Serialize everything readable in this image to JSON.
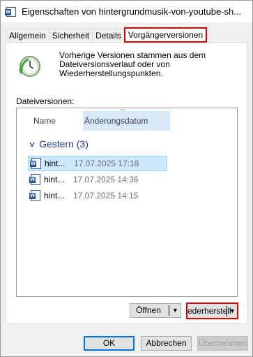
{
  "window": {
    "title": "Eigenschaften von hintergrundmusik-von-youtube-sh...",
    "icon": "word-document-icon"
  },
  "tabs": [
    {
      "label": "Allgemein",
      "active": false
    },
    {
      "label": "Sicherheit",
      "active": false
    },
    {
      "label": "Details",
      "active": false
    },
    {
      "label": "Vorgängerversionen",
      "active": true
    }
  ],
  "panel": {
    "info_text": "Vorherige Versionen stammen aus dem Dateiversionsverlauf oder von Wiederherstellungspunkten.",
    "versions_label": "Dateiversionen:",
    "columns": {
      "name": "Name",
      "date": "Änderungsdatum"
    },
    "group": {
      "label": "Gestern (3)"
    },
    "rows": [
      {
        "name": "hint...",
        "date": "17.07.2025 17:18",
        "selected": true
      },
      {
        "name": "hint...",
        "date": "17.07.2025 14:36",
        "selected": false
      },
      {
        "name": "hint...",
        "date": "17.07.2025 14:15",
        "selected": false
      }
    ],
    "open_button": "Öffnen",
    "restore_button": "ederherstell"
  },
  "footer": {
    "ok": "OK",
    "cancel": "Abbrechen",
    "apply": "Übernehmen"
  },
  "colors": {
    "highlight_border": "#e00000",
    "selection": "#cce8ff",
    "group_text": "#1e3a8a",
    "column_header_bg": "#d9eaf7"
  }
}
